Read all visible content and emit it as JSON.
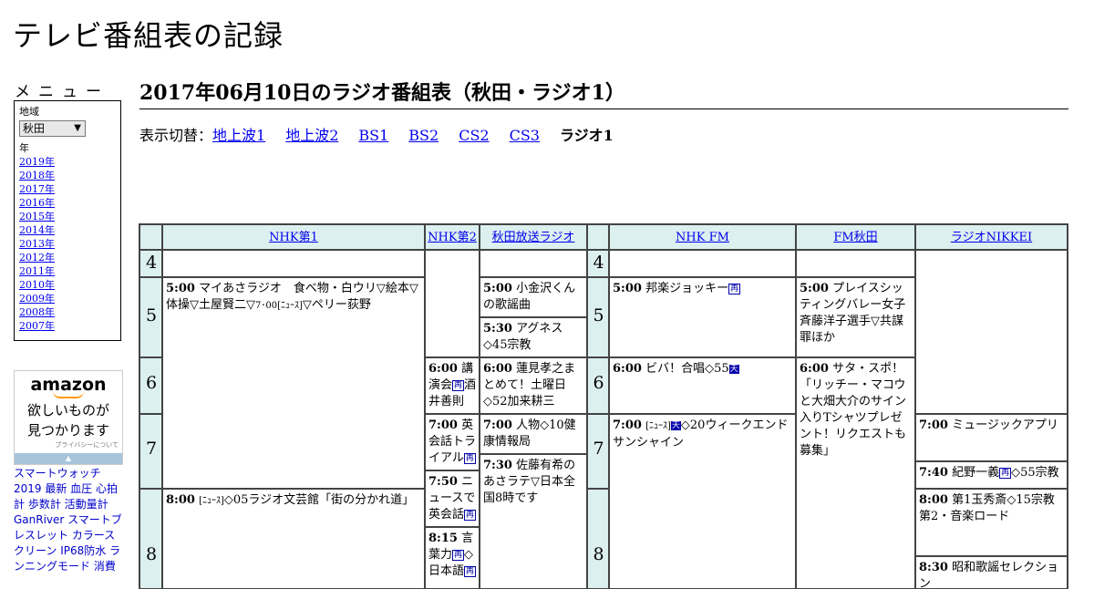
{
  "site_title": "テレビ番組表の記録",
  "menu": {
    "title": "メニュー",
    "region_label": "地域",
    "region_value": "秋田",
    "year_label": "年",
    "years": [
      "2019年",
      "2018年",
      "2017年",
      "2016年",
      "2015年",
      "2014年",
      "2013年",
      "2012年",
      "2011年",
      "2010年",
      "2009年",
      "2008年",
      "2007年"
    ]
  },
  "ad": {
    "logo": "amazon",
    "line1": "欲しいものが",
    "line2": "見つかります",
    "privacy": "プライバシーについて",
    "text": "スマートウォッチ 2019 最新 血圧 心拍計 歩数計 活動量計 GanRiver スマートブレスレット カラースクリーン IP68防水 ランニングモード 消費"
  },
  "main_title": "2017年06月10日のラジオ番組表（秋田・ラジオ1）",
  "switch": {
    "label": "表示切替：",
    "links": [
      "地上波1",
      "地上波2",
      "BS1",
      "BS2",
      "CS2",
      "CS3"
    ],
    "current": "ラジオ1"
  },
  "channels": [
    "NHK第1",
    "NHK第2",
    "秋田放送ラジオ",
    "NHK FM",
    "FM秋田",
    "ラジオNIKKEI"
  ],
  "hours": [
    "4",
    "5",
    "6",
    "7",
    "8"
  ],
  "programs": {
    "nhk1_a": {
      "time": "5:00",
      "title": "マイあさラジオ　食べ物・白ウリ▽絵本▽体操▽土屋賢二▽",
      "small": "7･00[ﾆｭｰｽ]",
      "rest": "▽ペリー荻野"
    },
    "nhk1_b": {
      "time": "8:00",
      "small": "[ﾆｭｰｽ]",
      "rest": "◇05ラジオ文芸館「街の分かれ道」"
    },
    "nhk2_a": {
      "time": "6:00",
      "title": "講演会",
      "mark": "再",
      "rest": "酒井善則"
    },
    "nhk2_b": {
      "time": "7:00",
      "title": "英会話トライアル",
      "mark": "再"
    },
    "nhk2_c": {
      "time": "7:50",
      "title": "ニュースで英会話",
      "mark": "再"
    },
    "nhk2_d": {
      "time": "8:15",
      "title": "言葉力",
      "mark": "再",
      "rest": "◇",
      "rest2": "日本語",
      "mark2": "再"
    },
    "abs_a": {
      "time": "5:00",
      "title": "小金沢くんの歌謡曲"
    },
    "abs_b": {
      "time": "5:30",
      "title": "アグネス◇45宗教"
    },
    "abs_c": {
      "time": "6:00",
      "title": "蓮見孝之まとめて！土曜日◇52加来耕三"
    },
    "abs_d": {
      "time": "7:00",
      "title": "人物◇10健康情報局"
    },
    "abs_e": {
      "time": "7:30",
      "title": "佐藤有希のあさラテ▽日本全国8時です"
    },
    "fm_a": {
      "time": "5:00",
      "title": "邦楽ジョッキー",
      "mark": "再"
    },
    "fm_b": {
      "time": "6:00",
      "title": "ビバ！合唱◇55",
      "mark": "天"
    },
    "fm_c": {
      "time": "7:00",
      "small": "[ﾆｭｰｽ]",
      "mark": "天",
      "rest": "◇20ウィークエンドサンシャイン"
    },
    "fma_a": {
      "time": "5:00",
      "title": "プレイスシッティングバレー女子斉藤洋子選手▽共謀罪ほか"
    },
    "fma_b": {
      "time": "6:00",
      "title": "サタ・スポ！「リッチー・マコウと大畑大介のサイン入りTシャツプレゼント！リクエストも募集」"
    },
    "nk_a": {
      "time": "7:00",
      "title": "ミュージックアプリ"
    },
    "nk_b": {
      "time": "7:40",
      "title": "紀野一義",
      "mark": "再",
      "rest": "◇55宗教"
    },
    "nk_c": {
      "time": "8:00",
      "title": "第1玉秀斎◇15宗教第2・音楽ロード"
    },
    "nk_d": {
      "time": "8:30",
      "title": "昭和歌謡セレクション"
    }
  }
}
